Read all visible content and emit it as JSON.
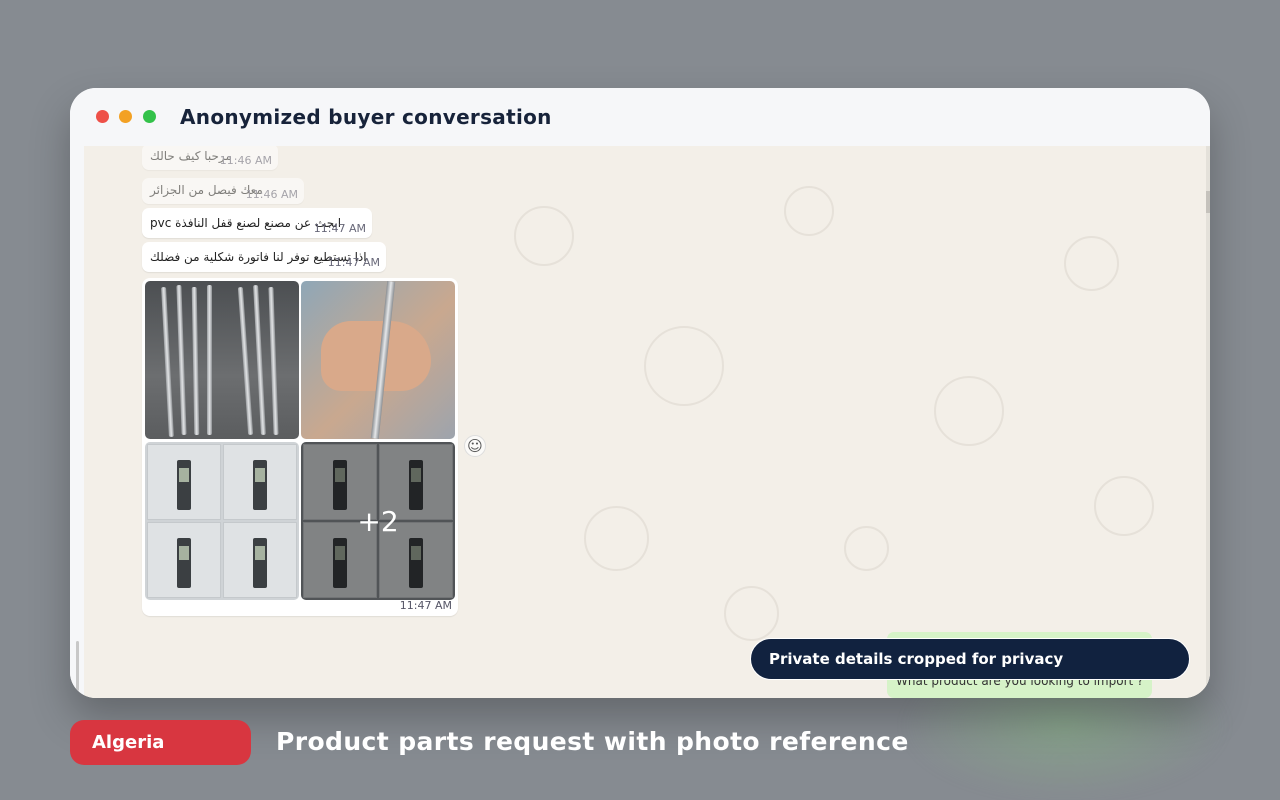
{
  "window": {
    "title": "Anonymized buyer conversation",
    "controls": [
      "close",
      "minimize",
      "maximize"
    ]
  },
  "messages": [
    {
      "text": "مرحبا كيف حالك",
      "time": "11:46 AM",
      "faded": true
    },
    {
      "text": "معك فيصل من الجزائر",
      "time": "11:46 AM",
      "faded": true
    },
    {
      "text": "ابحث عن مصنع لصنع قفل النافذة pvc",
      "time": "11:47 AM",
      "faded": false
    },
    {
      "text": "اذا تستطيع توفر لنا فاتورة شكلية من فضلك",
      "time": "11:47 AM",
      "faded": false
    }
  ],
  "media_message": {
    "more_count": "+2",
    "time": "11:47 AM",
    "react_icon": "emoji-smile-icon"
  },
  "reply": {
    "text": "What product are you looking to import ?"
  },
  "privacy_notice": "Private details cropped for privacy",
  "footer": {
    "country_tag": "Algeria",
    "caption": "Product parts request with photo reference"
  },
  "colors": {
    "background": "#868b91",
    "tag": "#d83640",
    "notice": "#11223f",
    "chat_bg": "#f3efe8",
    "reply_bubble": "#d6f3c8"
  }
}
